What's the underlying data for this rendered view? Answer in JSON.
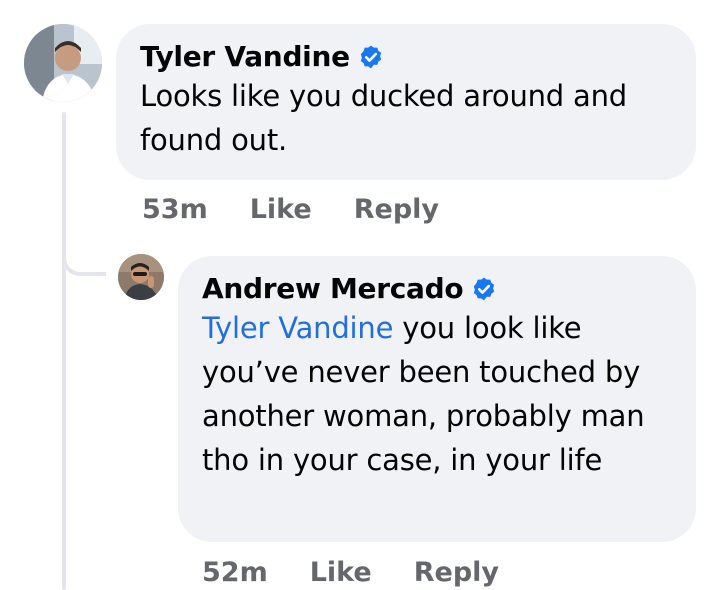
{
  "comments": [
    {
      "author": "Tyler Vandine",
      "text": "Looks like you ducked around and found out.",
      "time": "53m",
      "like_label": "Like",
      "reply_label": "Reply"
    },
    {
      "author": "Andrew Mercado",
      "mention": "Tyler Vandine",
      "text": " you look like you’ve never been touched by another woman, probably man tho in your case, in your life",
      "time": "52m",
      "like_label": "Like",
      "reply_label": "Reply"
    }
  ],
  "icons": {
    "verified": "verified-badge-icon",
    "verified_color": "#1877f2"
  },
  "colors": {
    "bubble": "#f0f2f5",
    "meta_text": "#65676b",
    "mention": "#216fdb",
    "thread_line": "#e4e6eb"
  }
}
